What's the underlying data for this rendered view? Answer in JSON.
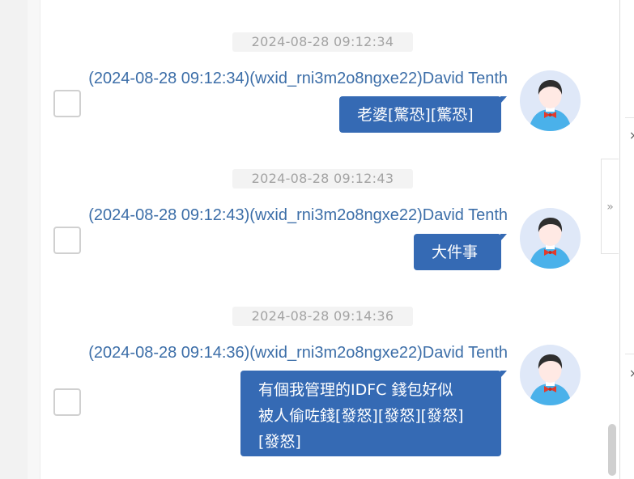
{
  "messages": [
    {
      "timestamp": "2024-08-28 09:12:34",
      "sender": "(2024-08-28 09:12:34)(wxid_rni3m2o8ngxe22)David Tenth",
      "lines": [
        "老婆[驚恐][驚恐]"
      ]
    },
    {
      "timestamp": "2024-08-28 09:12:43",
      "sender": "(2024-08-28 09:12:43)(wxid_rni3m2o8ngxe22)David Tenth",
      "lines": [
        "大件事"
      ]
    },
    {
      "timestamp": "2024-08-28 09:14:36",
      "sender": "(2024-08-28 09:14:36)(wxid_rni3m2o8ngxe22)David Tenth",
      "lines": [
        "有個我管理的IDFC 錢包好似",
        "被人偷咗錢[發怒][發怒][發怒]",
        "[發怒]"
      ]
    }
  ],
  "side_panel": {
    "collapse_glyph": "»",
    "close_glyph": "×"
  },
  "colors": {
    "bubble": "#356ab4",
    "sender_text": "#3c6ea8",
    "timestamp_text": "#a3a3a3"
  }
}
